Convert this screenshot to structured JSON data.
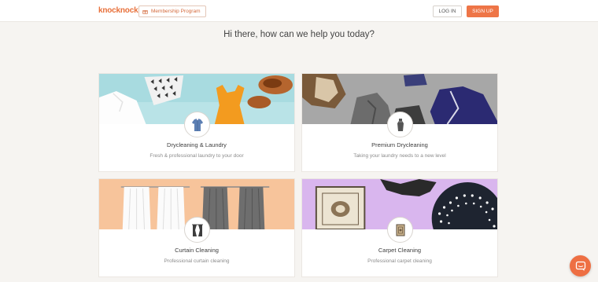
{
  "header": {
    "logo_text": "knocknock",
    "membership_label": "Membership Program",
    "login_label": "LOG IN",
    "signup_label": "SIGN UP"
  },
  "greeting": "Hi there, how can we help you today?",
  "services": [
    {
      "title": "Drycleaning & Laundry",
      "subtitle": "Fresh & professional laundry to your door",
      "icon": "shirt-icon"
    },
    {
      "title": "Premium Drycleaning",
      "subtitle": "Taking your laundry needs to a new level",
      "icon": "dress-icon"
    },
    {
      "title": "Curtain Cleaning",
      "subtitle": "Professional curtain cleaning",
      "icon": "curtain-icon"
    },
    {
      "title": "Carpet Cleaning",
      "subtitle": "Professional carpet cleaning",
      "icon": "rug-icon"
    }
  ],
  "colors": {
    "accent": "#ee7547",
    "page_bg": "#f6f4f1",
    "banner_laundry": "#a8dbe0",
    "banner_premium": "#a7a7a7",
    "banner_curtain": "#f7c49b",
    "banner_carpet": "#d9b6ee"
  },
  "chat_icon": "chat-bubble-icon"
}
